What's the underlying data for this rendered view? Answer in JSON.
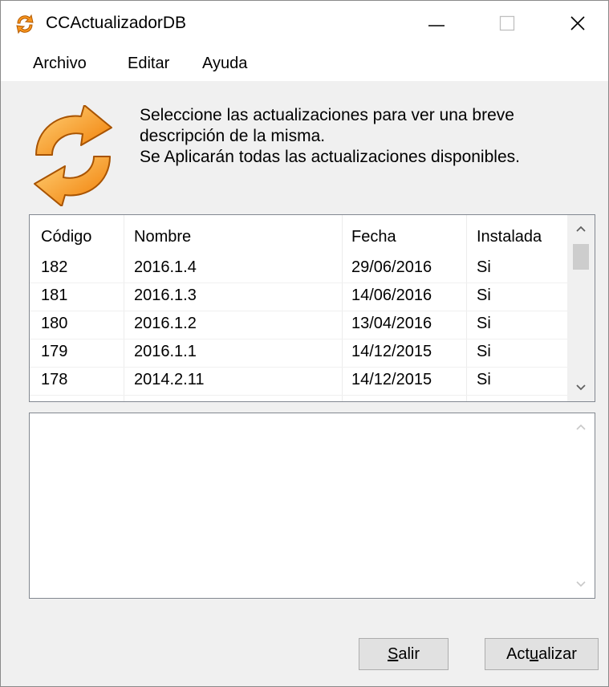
{
  "window": {
    "title": "CCActualizadorDB",
    "icons": {
      "app": "refresh-arrows-icon",
      "minimize": "minimize-icon",
      "maximize": "maximize-icon",
      "close": "close-icon"
    }
  },
  "menu": {
    "items": [
      {
        "label": "Archivo"
      },
      {
        "label": "Editar"
      },
      {
        "label": "Ayuda"
      }
    ]
  },
  "info": {
    "icon": "refresh-arrows-icon",
    "lines": [
      "Seleccione las actualizaciones para ver una breve",
      "descripción de la misma.",
      "Se Aplicarán todas las actualizaciones disponibles."
    ]
  },
  "updates": {
    "columns": [
      "Código",
      "Nombre",
      "Fecha",
      "Instalada"
    ],
    "rows": [
      [
        "182",
        "2016.1.4",
        "29/06/2016",
        "Si"
      ],
      [
        "181",
        "2016.1.3",
        "14/06/2016",
        "Si"
      ],
      [
        "180",
        "2016.1.2",
        "13/04/2016",
        "Si"
      ],
      [
        "179",
        "2016.1.1",
        "14/12/2015",
        "Si"
      ],
      [
        "178",
        "2014.2.11",
        "14/12/2015",
        "Si"
      ]
    ]
  },
  "description": {
    "text": ""
  },
  "buttons": {
    "exit": {
      "pre": "",
      "accel": "S",
      "post": "alir"
    },
    "update": {
      "pre": "Act",
      "accel": "u",
      "post": "alizar"
    }
  },
  "colors": {
    "accent": "#f7941d",
    "window_bg": "#f0f0f0",
    "border": "#828790"
  }
}
